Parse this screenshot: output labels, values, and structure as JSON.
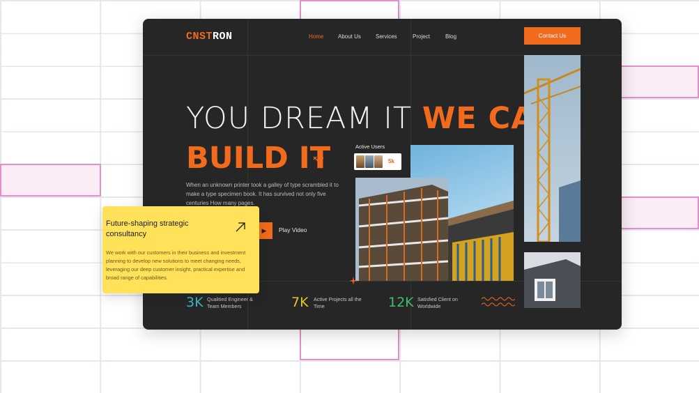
{
  "brand": {
    "logo_part1": "CNST",
    "logo_part2": "RON"
  },
  "nav": {
    "items": [
      "Home",
      "About Us",
      "Services",
      "Project",
      "Blog"
    ],
    "active": "Home",
    "contact_label": "Contact Us"
  },
  "hero": {
    "line1_light": "YOU DREAM IT",
    "line1_accent": "WE CAN",
    "line2": "BUILD IT",
    "description": "When an unknown printer took a galley of type scrambled it to make a type specimen book. It has survived not only five centuries How many pages.",
    "play_label": "Play Video"
  },
  "active_users": {
    "label": "Active Users",
    "count": "5k"
  },
  "stats": [
    {
      "value": "3K",
      "text": "Qualitied Engineer & Team Members",
      "color": "#3fb6c8"
    },
    {
      "value": "7K",
      "text": "Active Projects all the Time",
      "color": "#e8c22a"
    },
    {
      "value": "12K",
      "text": "Satisfied Client on Worldwide",
      "color": "#3cc06a"
    }
  ],
  "promo": {
    "title": "Future-shaping strategic consultancy",
    "description": "We work with our customers in their business and investment planning to develop new solutions to meet changing needs, leveraging our deep customer insight, practical expertise and broad range of capabilities."
  },
  "colors": {
    "accent": "#f26a1b",
    "card_bg": "#262626",
    "promo_bg": "#ffe15a"
  },
  "icons": [
    "play-icon",
    "arrow-up-right-icon",
    "squiggle-decoration-icon",
    "sparkle-icon",
    "tools-icon"
  ]
}
